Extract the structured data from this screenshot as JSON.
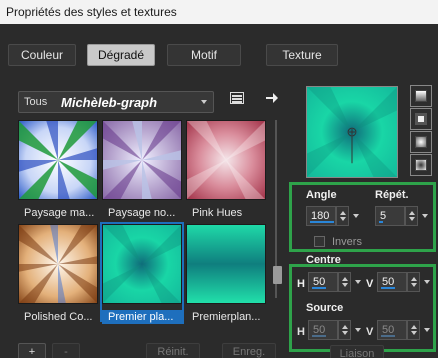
{
  "window": {
    "title": "Propriétés des styles et textures"
  },
  "tabs": [
    {
      "label": "Couleur",
      "active": false
    },
    {
      "label": "Dégradé",
      "active": true
    },
    {
      "label": "Motif",
      "active": false
    },
    {
      "label": "Texture",
      "active": false
    }
  ],
  "filter": {
    "category": "Tous",
    "selected": "Michèleb-graph"
  },
  "thumbnails": [
    {
      "label": "Paysage ma...",
      "selected": false,
      "style": "sunburst-green-blue"
    },
    {
      "label": "Paysage no...",
      "selected": false,
      "style": "sunburst-purple"
    },
    {
      "label": "Pink Hues",
      "selected": false,
      "style": "radial-pink"
    },
    {
      "label": "Polished Co...",
      "selected": false,
      "style": "sunburst-copper"
    },
    {
      "label": "Premier pla...",
      "selected": true,
      "style": "radial-teal"
    },
    {
      "label": "Premierplan...",
      "selected": false,
      "style": "radial-teal-2"
    }
  ],
  "scroll": {
    "position": 0.82
  },
  "colors": {
    "accent": "#1e6fbd",
    "highlight_box": "#2ea34a",
    "gradient_teal": "#19d6a6",
    "gradient_dark": "#0f6b7a"
  },
  "angle": {
    "label": "Angle",
    "value": "180",
    "fill": 1.0
  },
  "repeat": {
    "label": "Répét.",
    "value": "5",
    "fill": 0.05
  },
  "invert": {
    "label": "Invers",
    "checked": false
  },
  "centre": {
    "label": "Centre",
    "h_label": "H",
    "v_label": "V",
    "h_value": "50",
    "v_value": "50"
  },
  "source": {
    "label": "Source",
    "h_label": "H",
    "v_label": "V",
    "h_value": "50",
    "v_value": "50"
  },
  "footer": {
    "add": "+",
    "remove": "-",
    "reset": "Réinit.",
    "save": "Enreg.",
    "link": "Liaison"
  }
}
